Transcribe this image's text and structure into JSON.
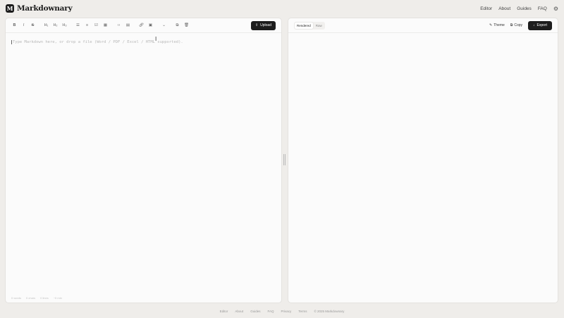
{
  "brand": {
    "logo_letter": "M",
    "name": "Markdownary"
  },
  "nav": {
    "items": [
      "Editor",
      "About",
      "Guides",
      "FAQ"
    ],
    "settings_icon": "gear-icon"
  },
  "editor": {
    "toolbar_icons": [
      "bold-icon",
      "italic-icon",
      "strikethrough-icon",
      "h1-icon",
      "h2-icon",
      "h3-icon",
      "bullet-list-icon",
      "numbered-list-icon",
      "task-list-icon",
      "table-icon",
      "code-icon",
      "code-block-icon",
      "link-icon",
      "image-icon",
      "more-icon",
      "copy-icon",
      "trash-icon"
    ],
    "upload_label": "Upload",
    "placeholder": "Type Markdown here, or drop a file (Word / PDF / Excel / HTML supported).",
    "stats": [
      "0 words",
      "0 chars",
      "0 lines",
      "~0 min"
    ]
  },
  "preview": {
    "modes": [
      "Rendered",
      "Raw"
    ],
    "active_mode": "Rendered",
    "theme_label": "Theme",
    "copy_label": "Copy",
    "export_label": "Export"
  },
  "footer": {
    "links": [
      "Editor",
      "About",
      "Guides",
      "FAQ",
      "Privacy",
      "Terms"
    ],
    "copyright": "© 2025 Markdownary"
  }
}
